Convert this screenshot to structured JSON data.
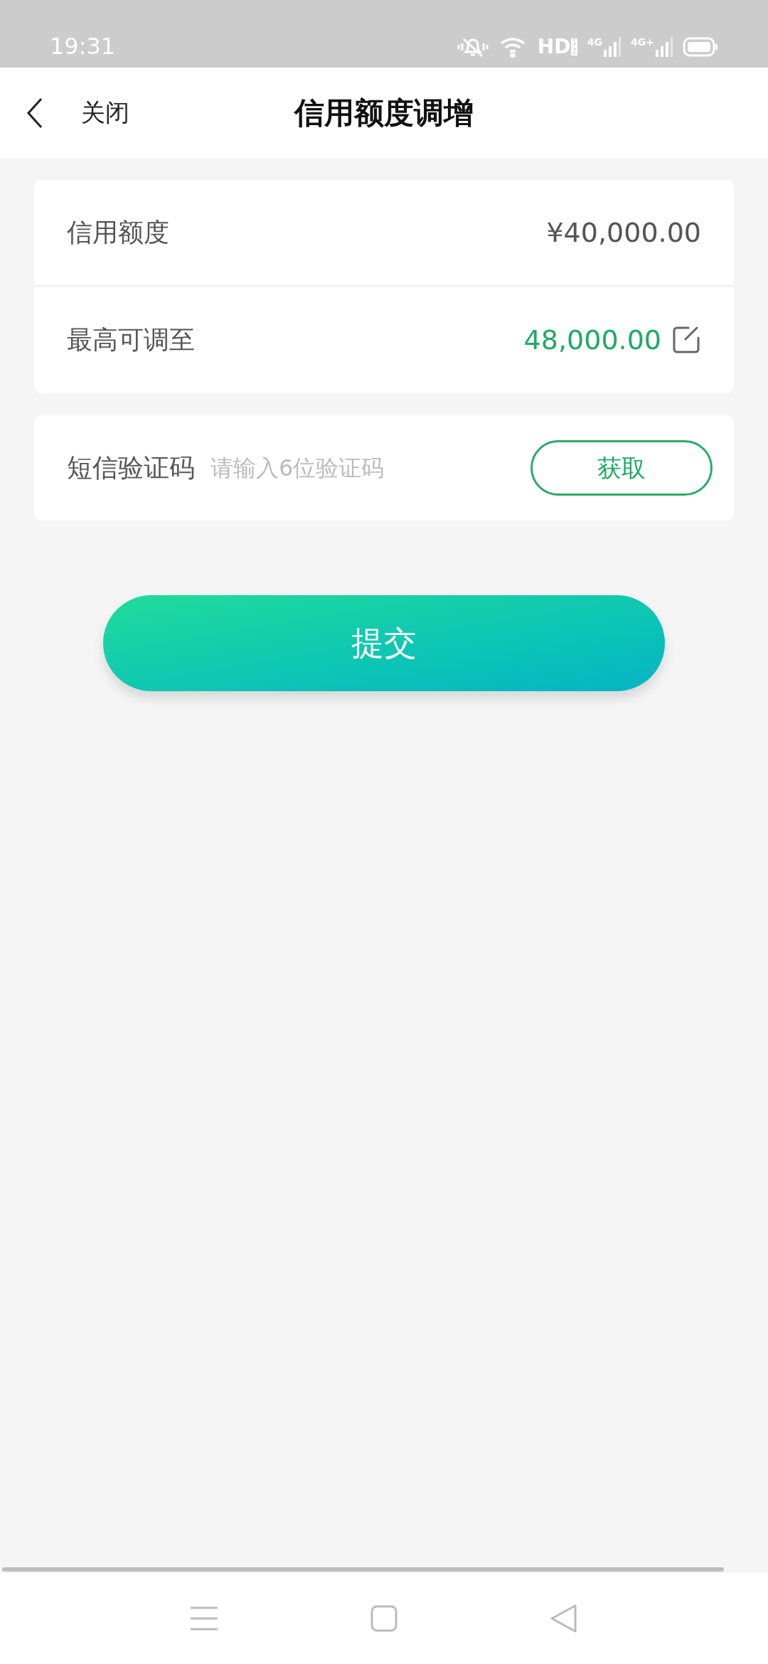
{
  "status_bar": {
    "time": "19:31",
    "hd": "HD",
    "hd_sims": [
      "1",
      "2"
    ],
    "networks": [
      "4G",
      "4G+"
    ]
  },
  "header": {
    "back": "关闭",
    "title": "信用额度调增"
  },
  "limit_card": {
    "rows": [
      {
        "kind": "plain",
        "label": "信用额度",
        "value": "¥40,000.00"
      },
      {
        "kind": "editable",
        "label": "最高可调至",
        "value": "48,000.00"
      }
    ]
  },
  "sms": {
    "label": "短信验证码",
    "placeholder": "请输入6位验证码",
    "button": "获取"
  },
  "submit": "提交"
}
